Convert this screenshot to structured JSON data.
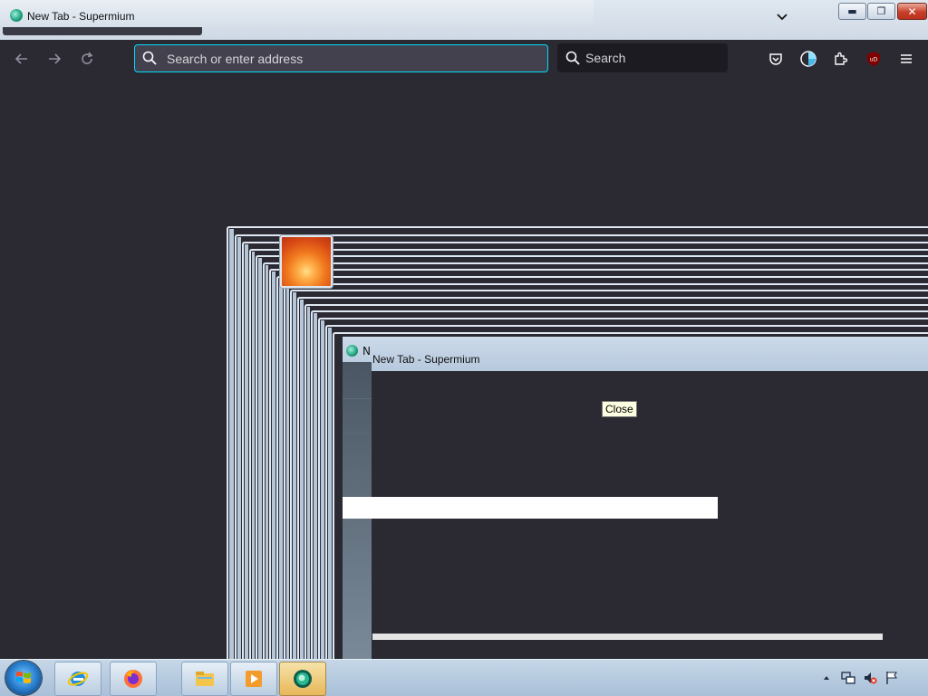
{
  "window": {
    "title": "New Tab - Supermium",
    "minimize_label": "▬",
    "restore_label": "❐",
    "close_label": "✕"
  },
  "toolbar": {
    "back_icon": "back-arrow-icon",
    "forward_icon": "forward-arrow-icon",
    "reload_icon": "reload-icon",
    "address_placeholder": "Search or enter address",
    "search_label": "Search",
    "icons": [
      "pocket-icon",
      "account-icon",
      "extensions-icon",
      "ublock-icon",
      "menu-icon"
    ]
  },
  "inner_window": {
    "title_fragment": "N",
    "title": "New Tab - Supermium"
  },
  "tooltip": {
    "text": "Close"
  },
  "taskbar": {
    "buttons": [
      "internet-explorer-icon",
      "firefox-icon",
      "file-explorer-icon",
      "media-player-icon",
      "supermium-icon"
    ],
    "active_index": 4
  },
  "tray": {
    "icons": [
      "show-hidden-icons-icon",
      "network-icon",
      "volume-muted-icon",
      "action-center-flag-icon"
    ]
  },
  "colors": {
    "toolbar_bg": "#2b2a33",
    "urlbar_bg": "#42414d",
    "urlbar_focus": "#00ddff",
    "searchbar_bg": "#1c1b22"
  }
}
